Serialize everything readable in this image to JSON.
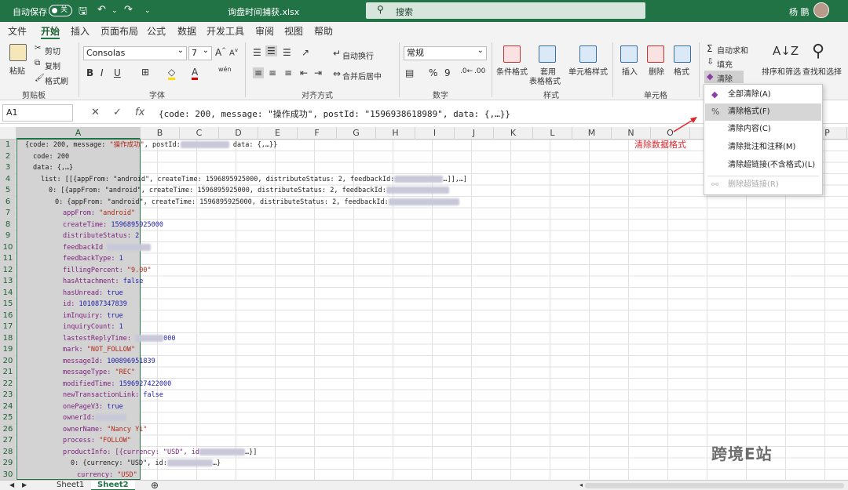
{
  "titlebar": {
    "autosave_label": "自动保存",
    "autosave_state": "关",
    "doc_title": "询盘时间捕获.xlsx",
    "search_placeholder": "搜索",
    "user_name": "杨 鹏"
  },
  "tabs": [
    "文件",
    "开始",
    "插入",
    "页面布局",
    "公式",
    "数据",
    "开发工具",
    "审阅",
    "视图",
    "帮助"
  ],
  "ribbon": {
    "clipboard": {
      "paste": "粘贴",
      "cut": "剪切",
      "copy": "复制",
      "format_painter": "格式刷",
      "label": "剪贴板"
    },
    "font": {
      "name": "Consolas",
      "size": "7",
      "label": "字体"
    },
    "alignment": {
      "wrap": "自动换行",
      "merge": "合并后居中",
      "label": "对齐方式"
    },
    "number": {
      "format": "常规",
      "label": "数字"
    },
    "styles": {
      "conditional": "条件格式",
      "table1": "套用",
      "table2": "表格格式",
      "cell_style": "单元格样式",
      "label": "样式"
    },
    "cells": {
      "insert": "插入",
      "delete": "删除",
      "format": "格式",
      "label": "单元格"
    },
    "editing": {
      "autosum": "自动求和",
      "fill": "填充",
      "clear": "清除",
      "sort": "排序和筛选",
      "find": "查找和选择"
    }
  },
  "formula_bar": {
    "name_box": "A1",
    "formula": "{code: 200, message: \"操作成功\", postId: \"1596938618989\", data: {,…}}"
  },
  "columns": [
    "A",
    "B",
    "C",
    "D",
    "E",
    "F",
    "G",
    "H",
    "I",
    "J",
    "K",
    "L",
    "M",
    "N",
    "O",
    "P"
  ],
  "rows": [
    "1",
    "2",
    "3",
    "4",
    "5",
    "6",
    "7",
    "8",
    "9",
    "10",
    "11",
    "12",
    "13",
    "14",
    "15",
    "16",
    "17",
    "18",
    "19",
    "20",
    "21",
    "22",
    "23",
    "24",
    "25",
    "26",
    "27",
    "28",
    "29",
    "30"
  ],
  "cells": {
    "r1a": "{code: 200, message: ",
    "r1b": "\"操作成功\"",
    "r1c": ", postId:",
    "r1d": " data: {,…}}",
    "r2": "code: 200",
    "r3": "data: {,…}",
    "r4a": "list: [[{appFrom: \"android\", createTime: 1596895925000, distributeStatus: 2, feedbackId:",
    "r4b": "…]],…]",
    "r5": "0: [{appFrom: \"android\", createTime: 1596895925000, distributeStatus: 2, feedbackId:",
    "r6": "0: {appFrom: \"android\", createTime: 1596895925000, distributeStatus: 2, feedbackId:",
    "r7k": "appFrom: ",
    "r7v": "\"android\"",
    "r8k": "createTime: ",
    "r8v": "1596895925000",
    "r9k": "distributeStatus: ",
    "r9v": "2",
    "r10k": "feedbackId",
    "r11k": "feedbackType: ",
    "r11v": "1",
    "r12k": "fillingPercent: ",
    "r12v": "\"9.00\"",
    "r13k": "hasAttachment: ",
    "r13v": "false",
    "r14k": "hasUnread: ",
    "r14v": "true",
    "r15k": "id: ",
    "r15v": "101087347839",
    "r16k": "imInquiry: ",
    "r16v": "true",
    "r17k": "inquiryCount: ",
    "r17v": "1",
    "r18k": "lastestReplyTime: ",
    "r18v": "000",
    "r19k": "mark: ",
    "r19v": "\"NOT_FOLLOW\"",
    "r20k": "messageId: ",
    "r20v": "100896951839",
    "r21k": "messageType: ",
    "r21v": "\"REC\"",
    "r22k": "modifiedTime: ",
    "r22v": "1596927422000",
    "r23k": "newTransactionLink: ",
    "r23v": "false",
    "r24k": "onePageV3: ",
    "r24v": "true",
    "r25k": "ownerId:",
    "r26k": "ownerName: ",
    "r26v": "\"Nancy Yi\"",
    "r27k": "process: ",
    "r27v": "\"FOLLOW\"",
    "r28a": "productInfo: [{currency: \"USD\", id",
    "r28b": "…}]",
    "r29a": "0: {currency: \"USD\", id:",
    "r29b": "…}",
    "r30k": "currency: ",
    "r30v": "\"USD\""
  },
  "clear_menu": [
    {
      "label": "全部清除(A)",
      "icon": "eraser-icon",
      "enabled": true
    },
    {
      "label": "清除格式(F)",
      "icon": "clear-format-icon",
      "enabled": true
    },
    {
      "label": "清除内容(C)",
      "icon": "none",
      "enabled": true
    },
    {
      "label": "清除批注和注释(M)",
      "icon": "none",
      "enabled": true
    },
    {
      "label": "清除超链接(不含格式)(L)",
      "icon": "none",
      "enabled": true
    },
    {
      "label": "删除超链接(R)",
      "icon": "unlink-icon",
      "enabled": false
    }
  ],
  "annotation": "清除数据格式",
  "sheets": [
    "Sheet1",
    "Sheet2"
  ],
  "active_sheet": "Sheet2",
  "watermark": "跨境E站",
  "colors": {
    "excel_green": "#217346",
    "annotation_red": "#e0242a"
  }
}
